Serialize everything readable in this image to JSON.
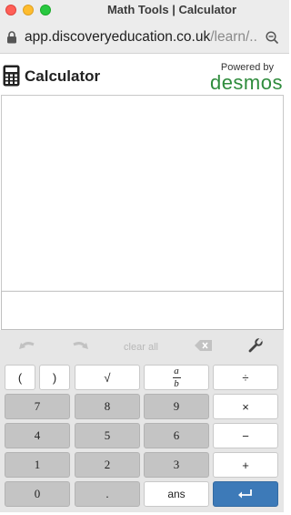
{
  "window": {
    "title": "Math Tools | Calculator",
    "url_main": "app.discoveryeducation.co.uk",
    "url_dim": "/learn/..."
  },
  "header": {
    "title": "Calculator",
    "powered_by": "Powered by",
    "brand": "desmos"
  },
  "toolbar": {
    "undo_icon": "undo-arrow-icon",
    "redo_icon": "redo-arrow-icon",
    "clear_all": "clear all",
    "backspace_icon": "backspace-icon",
    "settings_icon": "wrench-icon"
  },
  "keypad": {
    "row1": [
      "(",
      ")",
      "√",
      "a/b",
      "÷"
    ],
    "row2": [
      "7",
      "8",
      "9",
      "×"
    ],
    "row3": [
      "4",
      "5",
      "6",
      "−"
    ],
    "row4": [
      "1",
      "2",
      "3",
      "+"
    ],
    "row5": [
      "0",
      ".",
      "ans",
      "↵"
    ],
    "fraction": {
      "numerator": "a",
      "denominator": "b"
    }
  },
  "colors": {
    "accent_blue": "#3d7ab8",
    "desmos_green": "#2f8c3d",
    "key_gray": "#c4c4c4"
  }
}
